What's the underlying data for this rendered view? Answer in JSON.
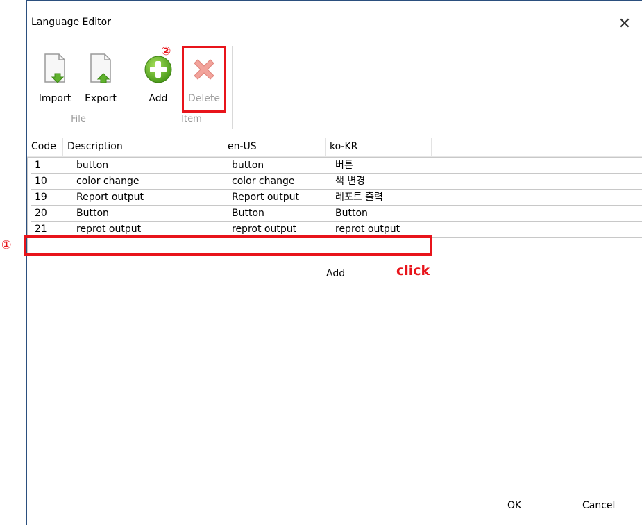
{
  "window": {
    "title": "Language Editor",
    "close_glyph": "✕"
  },
  "ribbon": {
    "buttons": [
      {
        "label": "Import",
        "icon": "import-icon"
      },
      {
        "label": "Export",
        "icon": "export-icon"
      },
      {
        "label": "Add",
        "icon": "add-circle-icon"
      },
      {
        "label": "Delete",
        "icon": "delete-x-icon"
      }
    ],
    "groups": [
      "File",
      "Item"
    ]
  },
  "grid": {
    "columns": [
      "Code",
      "Description",
      "en-US",
      "ko-KR"
    ],
    "rows": [
      [
        "1",
        "button",
        "button",
        "버튼"
      ],
      [
        "10",
        "color change",
        "color change",
        "색 변경"
      ],
      [
        "19",
        "Report output",
        "Report output",
        "레포트 출력"
      ],
      [
        "20",
        "Button",
        "Button",
        "Button"
      ],
      [
        "21",
        "reprot output",
        "reprot output",
        "reprot output"
      ]
    ],
    "add_label": "Add"
  },
  "footer": {
    "ok_label": "OK",
    "cancel_label": "Cancel"
  },
  "annotations": {
    "marker_1": "①",
    "marker_2": "②",
    "click_label": "click",
    "color": "#e8141b"
  }
}
